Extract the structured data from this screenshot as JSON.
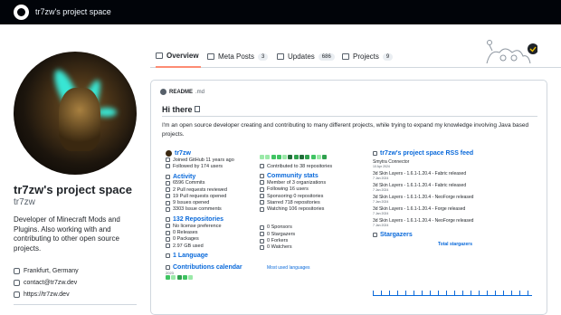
{
  "topbar": {
    "title": "tr7zw's project space"
  },
  "tabs": [
    {
      "label": "Overview",
      "count": ""
    },
    {
      "label": "Meta Posts",
      "count": "3"
    },
    {
      "label": "Updates",
      "count": "686"
    },
    {
      "label": "Projects",
      "count": "9"
    }
  ],
  "profile": {
    "name": "tr7zw's project space",
    "login": "tr7zw",
    "bio": "Developer of Minecraft Mods and Plugins. Also working with and contributing to other open source projects.",
    "location": "Frankfurt, Germany",
    "email": "contact@tr7zw.dev",
    "website": "https://tr7zw.dev"
  },
  "readme": {
    "file": "README",
    "ext": ".md",
    "heading": "Hi there",
    "intro": "I'm an open source developer creating and contributing to many different projects, while trying to expand my knowledge involving Java based projects."
  },
  "stats": {
    "user": "tr7zw",
    "joined": "Joined GitHub 11 years ago",
    "followed": "Followed by 174 users",
    "contributed": "Contributed to 38 repositories",
    "activity_title": "Activity",
    "activity": [
      "6596 Commits",
      "2 Pull requests reviewed",
      "19 Pull requests opened",
      "9 Issues opened",
      "3303 Issue comments"
    ],
    "community_title": "Community stats",
    "community": [
      "Member of 3 organizations",
      "Following 16 users",
      "Sponsoring 0 repositories",
      "Starred 718 repositories",
      "Watching 106 repositories"
    ],
    "repos_title": "132 Repositories",
    "repos": [
      "No license preference",
      "0 Releases",
      "0 Packages",
      "2.97 GB used"
    ],
    "repos_right": [
      "0 Sponsors",
      "0 Stargazers",
      "0 Forkers",
      "0 Watchers"
    ],
    "language_title": "1 Language",
    "languages_caption": "Most used languages",
    "calendar_title": "Contributions calendar",
    "calendar_year": "2023"
  },
  "rss": {
    "title": "tr7zw's project space RSS feed",
    "items": [
      {
        "title": "Smytra Connector",
        "date": "10 Apr 2024"
      },
      {
        "title": "3d Skin Layers - 1.6.1-1.20.4 - Fabric released",
        "date": "7 Jan 2024"
      },
      {
        "title": "3d Skin Layers - 1.6.1-1.20.4 - Fabric released",
        "date": "7 Jan 2024"
      },
      {
        "title": "3d Skin Layers - 1.6.1-1.20.4 - NeoForge released",
        "date": "7 Jan 2024"
      },
      {
        "title": "3d Skin Layers - 1.6.1-1.20.4 - Forge released",
        "date": "7 Jan 2024"
      },
      {
        "title": "3d Skin Layers - 1.6.1-1.20.4 - NeoForge released",
        "date": "7 Jan 2024"
      }
    ],
    "stargazers_title": "Stargazers",
    "total_stargazers": "Total stargazers"
  }
}
